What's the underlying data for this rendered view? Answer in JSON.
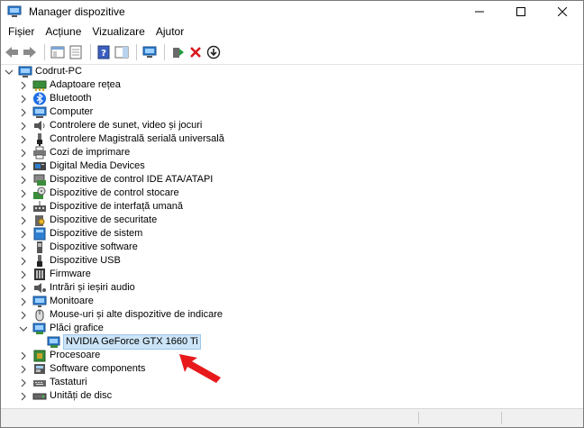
{
  "window": {
    "title": "Manager dispozitive"
  },
  "menu": [
    "Fișier",
    "Acțiune",
    "Vizualizare",
    "Ajutor"
  ],
  "tree": {
    "root": "Codrut-PC",
    "categories": [
      {
        "label": "Adaptoare rețea",
        "icon": "network-adapter-icon"
      },
      {
        "label": "Bluetooth",
        "icon": "bluetooth-icon"
      },
      {
        "label": "Computer",
        "icon": "computer-icon"
      },
      {
        "label": "Controlere de sunet, video și jocuri",
        "icon": "speaker-icon"
      },
      {
        "label": "Controlere Magistrală serială universală",
        "icon": "usb-connector-icon"
      },
      {
        "label": "Cozi de imprimare",
        "icon": "printer-icon"
      },
      {
        "label": "Digital Media Devices",
        "icon": "media-device-icon"
      },
      {
        "label": "Dispozitive de control IDE ATA/ATAPI",
        "icon": "ide-controller-icon"
      },
      {
        "label": "Dispozitive de control stocare",
        "icon": "storage-controller-icon"
      },
      {
        "label": "Dispozitive de interfață umană",
        "icon": "hid-icon"
      },
      {
        "label": "Dispozitive de securitate",
        "icon": "security-device-icon"
      },
      {
        "label": "Dispozitive de sistem",
        "icon": "system-device-icon"
      },
      {
        "label": "Dispozitive software",
        "icon": "software-device-icon"
      },
      {
        "label": "Dispozitive USB",
        "icon": "usb-device-icon"
      },
      {
        "label": "Firmware",
        "icon": "firmware-icon"
      },
      {
        "label": "Intrări și ieșiri audio",
        "icon": "audio-io-icon"
      },
      {
        "label": "Monitoare",
        "icon": "monitor-icon"
      },
      {
        "label": "Mouse-uri și alte dispozitive de indicare",
        "icon": "mouse-icon"
      },
      {
        "label": "Plăci grafice",
        "icon": "display-adapter-icon",
        "expanded": true,
        "children": [
          {
            "label": "NVIDIA GeForce GTX 1660 Ti",
            "icon": "display-adapter-icon",
            "selected": true
          }
        ]
      },
      {
        "label": "Procesoare",
        "icon": "processor-icon"
      },
      {
        "label": "Software components",
        "icon": "software-component-icon"
      },
      {
        "label": "Tastaturi",
        "icon": "keyboard-icon"
      },
      {
        "label": "Unități de disc",
        "icon": "disk-drive-icon"
      }
    ]
  },
  "colors": {
    "arrow": "#e8191b",
    "selection": "#cce4f7",
    "selection_border": "#9cc6ea"
  }
}
